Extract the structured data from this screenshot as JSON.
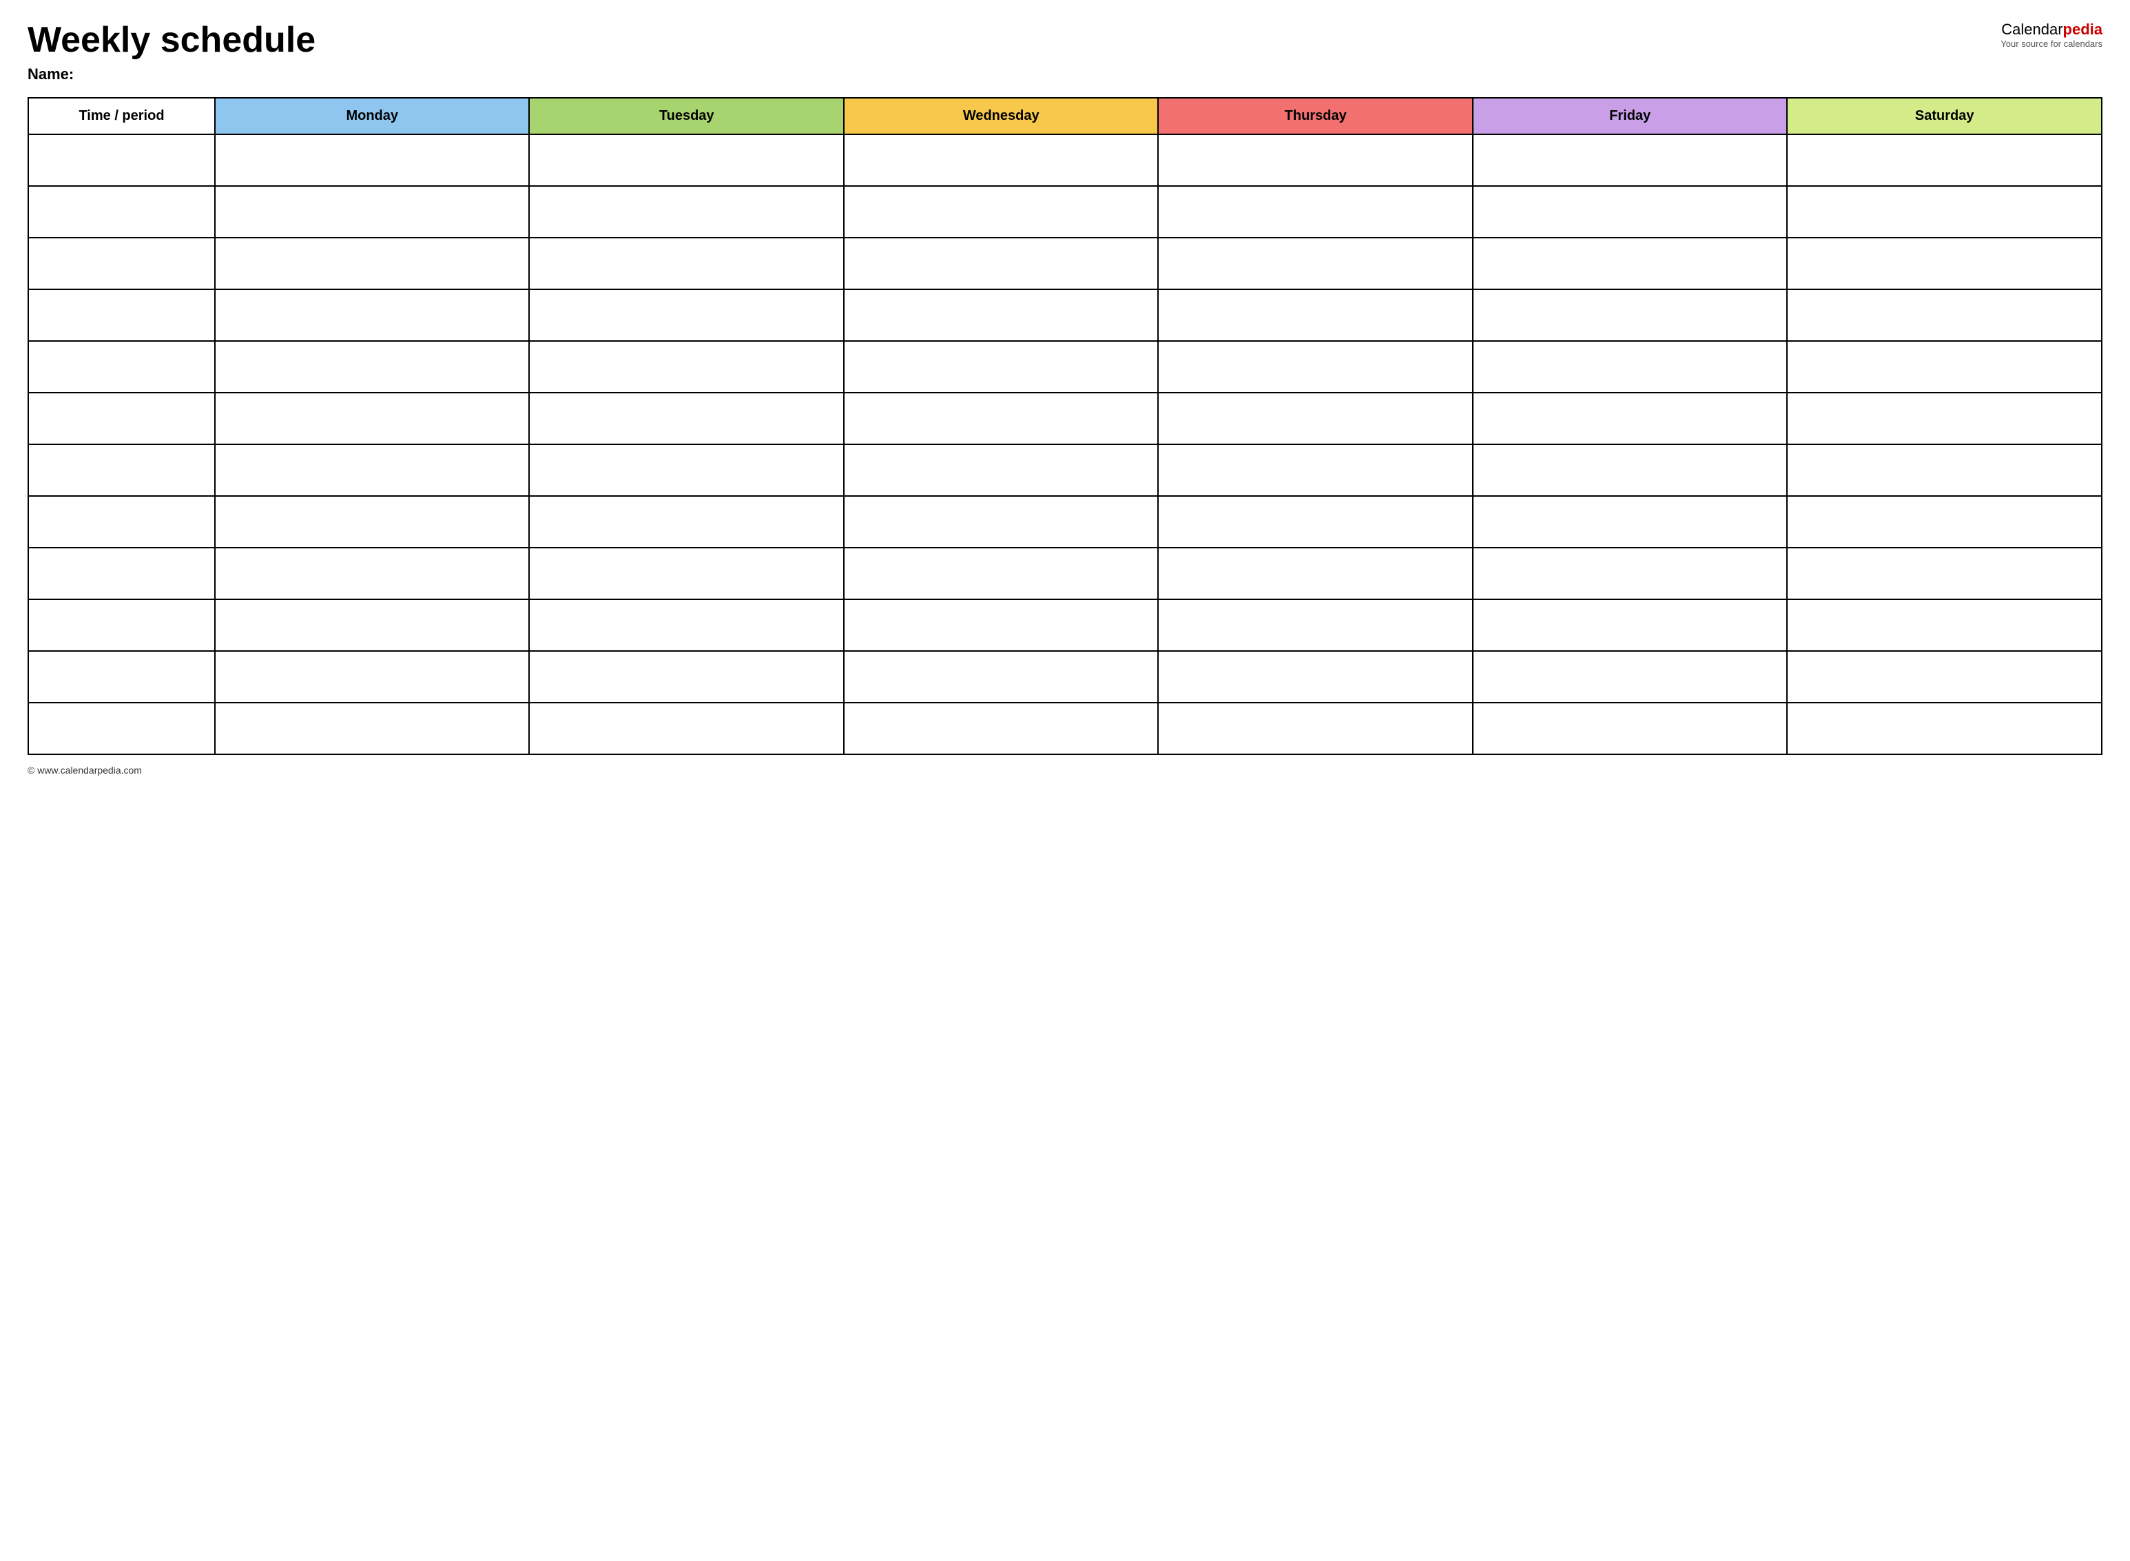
{
  "header": {
    "title": "Weekly schedule",
    "name_label": "Name:",
    "logo_calendar": "Calendar",
    "logo_pedia": "pedia",
    "logo_tagline": "Your source for calendars"
  },
  "table": {
    "columns": [
      {
        "id": "time",
        "label": "Time / period",
        "color": "#ffffff"
      },
      {
        "id": "monday",
        "label": "Monday",
        "color": "#8ec6f0"
      },
      {
        "id": "tuesday",
        "label": "Tuesday",
        "color": "#a8d46f"
      },
      {
        "id": "wednesday",
        "label": "Wednesday",
        "color": "#f7c84b"
      },
      {
        "id": "thursday",
        "label": "Thursday",
        "color": "#f27070"
      },
      {
        "id": "friday",
        "label": "Friday",
        "color": "#c9a0e8"
      },
      {
        "id": "saturday",
        "label": "Saturday",
        "color": "#d4eb8a"
      }
    ],
    "row_count": 12
  },
  "footer": {
    "url": "© www.calendarpedia.com"
  }
}
